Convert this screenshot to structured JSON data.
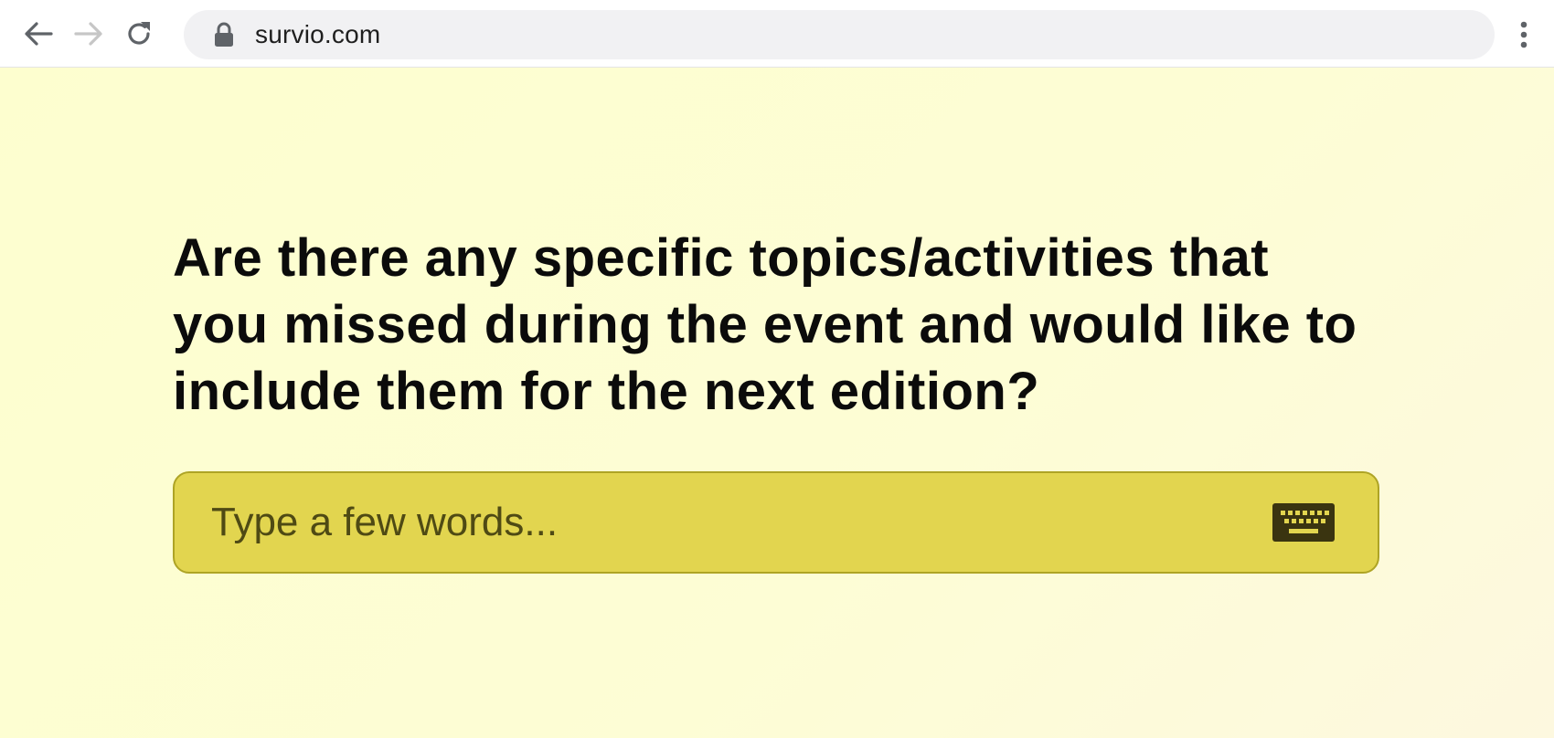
{
  "browser": {
    "url": "survio.com",
    "back_icon": "arrow-left-icon",
    "forward_icon": "arrow-right-icon",
    "reload_icon": "reload-icon",
    "lock_icon": "lock-icon",
    "menu_icon": "kebab-menu-icon"
  },
  "survey": {
    "question": "Are there any specific topics/activities that you missed during the event and would like to include them for the next edition?",
    "answer_placeholder": "Type a few words...",
    "answer_value": "",
    "keyboard_icon": "keyboard-icon"
  },
  "colors": {
    "page_background": "#fdfecf",
    "answer_fill": "#e2d54f",
    "answer_border": "#aea425",
    "text": "#0b0b0b"
  }
}
